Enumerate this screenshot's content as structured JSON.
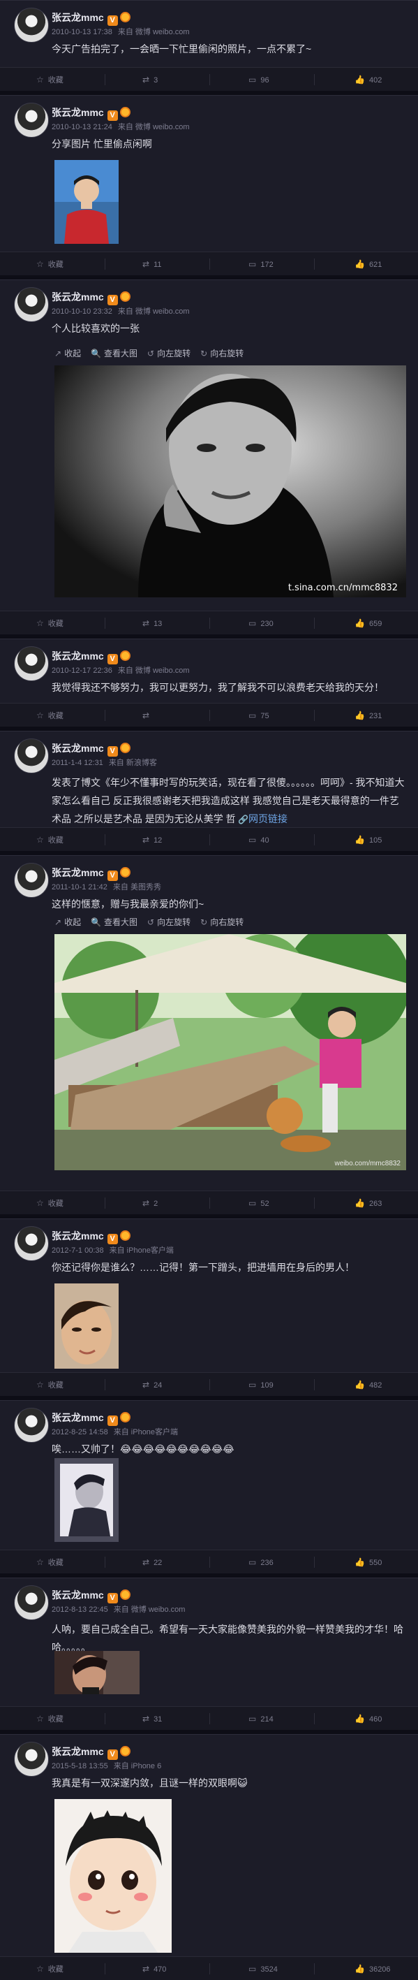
{
  "user": {
    "name": "张云龙mmc",
    "verified_mark": "V"
  },
  "posts": [
    {
      "time": "2010-10-13 17:38",
      "via": "来自 微博 weibo.com",
      "text": "今天广告拍完了，一会晒一下忙里偷闲的照片，一点不累了~",
      "actions": {
        "fav": "收藏",
        "repost": "3",
        "comment": "96",
        "like": "402"
      }
    },
    {
      "time": "2010-10-13 21:24",
      "via": "来自 微博 weibo.com",
      "text": "分享图片 忙里偷点闲啊",
      "actions": {
        "fav": "收藏",
        "repost": "11",
        "comment": "172",
        "like": "621"
      }
    },
    {
      "time": "2010-10-10 23:32",
      "via": "来自 微博 weibo.com",
      "text": "个人比较喜欢的一张",
      "toolbar": {
        "collapse": "收起",
        "view_large": "查看大图",
        "rotate_left": "向左旋转",
        "rotate_right": "向右旋转"
      },
      "watermark": "t.sina.com.cn/mmc8832",
      "actions": {
        "fav": "收藏",
        "repost": "13",
        "comment": "230",
        "like": "659"
      }
    },
    {
      "time": "2010-12-17 22:36",
      "via": "来自 微博 weibo.com",
      "text": "我觉得我还不够努力，我可以更努力，我了解我不可以浪费老天给我的天分！",
      "actions": {
        "fav": "收藏",
        "repost": "",
        "comment": "75",
        "like": "231"
      }
    },
    {
      "time": "2011-1-4 12:31",
      "via": "来自 新浪博客",
      "text": "发表了博文《年少不懂事时写的玩笑话，现在看了很傻。。。。。。呵呵》- 我不知道大家怎么看自己 反正我很感谢老天把我造成这样 我感觉自己是老天最得意的一件艺术品 之所以是艺术品 是因为无论从美学 哲",
      "link": "网页链接",
      "actions": {
        "fav": "收藏",
        "repost": "12",
        "comment": "40",
        "like": "105"
      }
    },
    {
      "time": "2011-10-1 21:42",
      "via": "来自 美图秀秀",
      "text": "这样的惬意，赠与我最亲爱的你们~",
      "toolbar": {
        "collapse": "收起",
        "view_large": "查看大图",
        "rotate_left": "向左旋转",
        "rotate_right": "向右旋转"
      },
      "watermark": "weibo.com/mmc8832",
      "actions": {
        "fav": "收藏",
        "repost": "2",
        "comment": "52",
        "like": "263"
      }
    },
    {
      "time": "2012-7-1 00:38",
      "via": "来自 iPhone客户端",
      "text": "你还记得你是谁么？……记得！第一下蹭头，把进墙用在身后的男人！",
      "actions": {
        "fav": "收藏",
        "repost": "24",
        "comment": "109",
        "like": "482"
      }
    },
    {
      "time": "2012-8-25 14:58",
      "via": "来自 iPhone客户端",
      "text": "唉……又帅了！😂😂😂😂😂😂😂😂😂😂",
      "actions": {
        "fav": "收藏",
        "repost": "22",
        "comment": "236",
        "like": "550"
      }
    },
    {
      "time": "2012-8-13 22:45",
      "via": "来自 微博 weibo.com",
      "text": "人呐，要自己成全自己。希望有一天大家能像赞美我的外貌一样赞美我的才华！哈哈。。。。。",
      "actions": {
        "fav": "收藏",
        "repost": "31",
        "comment": "214",
        "like": "460"
      }
    },
    {
      "time": "2015-5-18 13:55",
      "via": "来自 iPhone 6",
      "text": "我真是有一双深邃内敛，且谜一样的双眼啊😺",
      "actions": {
        "fav": "收藏",
        "repost": "470",
        "comment": "3524",
        "like": "36206"
      }
    }
  ]
}
